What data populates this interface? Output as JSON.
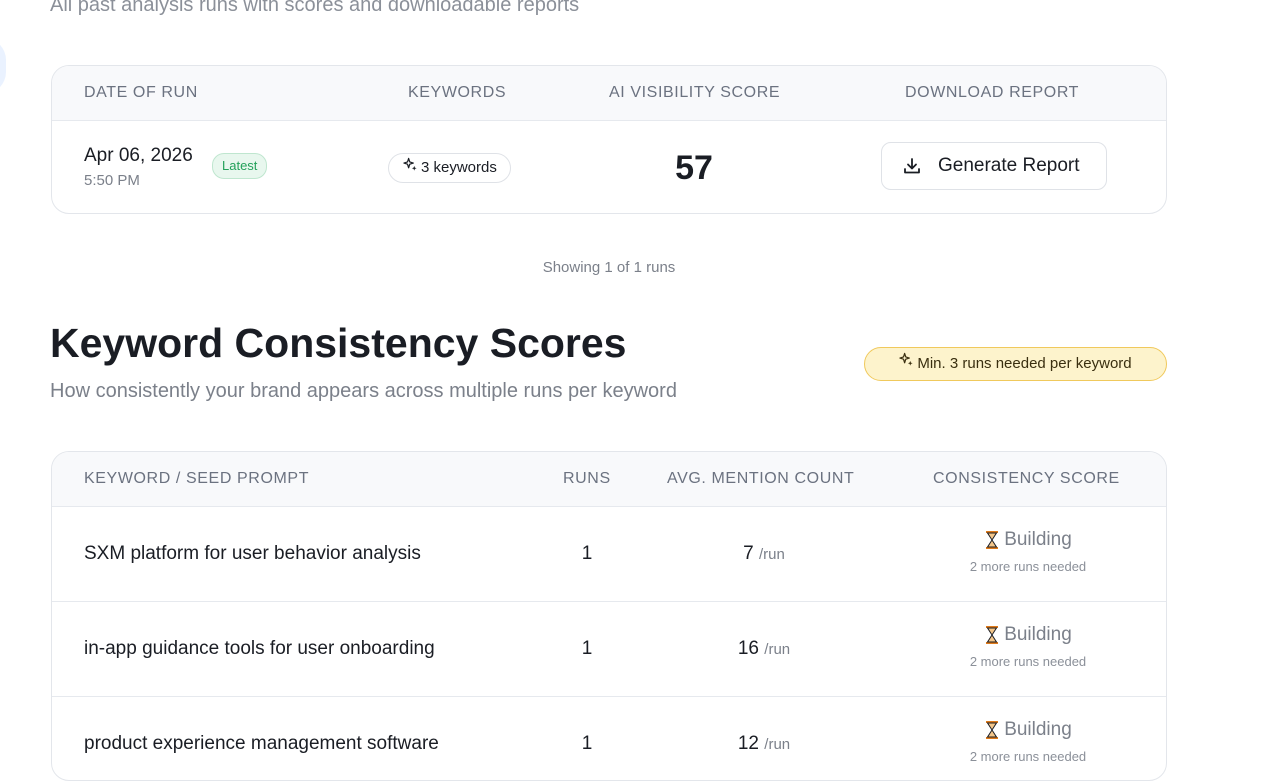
{
  "history": {
    "subtitle": "All past analysis runs with scores and downloadable reports",
    "columns": [
      "DATE OF RUN",
      "KEYWORDS",
      "AI VISIBILITY SCORE",
      "DOWNLOAD REPORT"
    ],
    "run": {
      "date": "Apr 06, 2026",
      "time": "5:50 PM",
      "badge": "Latest",
      "keywords": "3 keywords",
      "score": "57",
      "button": "Generate Report"
    },
    "showing": "Showing 1 of 1 runs"
  },
  "consistency": {
    "title": "Keyword Consistency Scores",
    "subtitle": "How consistently your brand appears across multiple runs per keyword",
    "min_badge": "Min. 3 runs needed per keyword",
    "columns": [
      "KEYWORD / SEED PROMPT",
      "RUNS",
      "AVG. MENTION COUNT",
      "CONSISTENCY SCORE"
    ],
    "unit": "/run",
    "rows": [
      {
        "keyword": "SXM platform for user behavior analysis",
        "runs": "1",
        "avg": "7",
        "status": "Building",
        "note": "2 more runs needed"
      },
      {
        "keyword": "in-app guidance tools for user onboarding",
        "runs": "1",
        "avg": "16",
        "status": "Building",
        "note": "2 more runs needed"
      },
      {
        "keyword": "product experience management software",
        "runs": "1",
        "avg": "12",
        "status": "Building",
        "note": "2 more runs needed"
      }
    ]
  },
  "colors": {
    "accent_green": "#23a15a",
    "warning_yellow": "#fdf3cc",
    "hourglass": "#e07b1a"
  },
  "icons": [
    "download-icon",
    "sparkle-icon",
    "hourglass-icon"
  ]
}
